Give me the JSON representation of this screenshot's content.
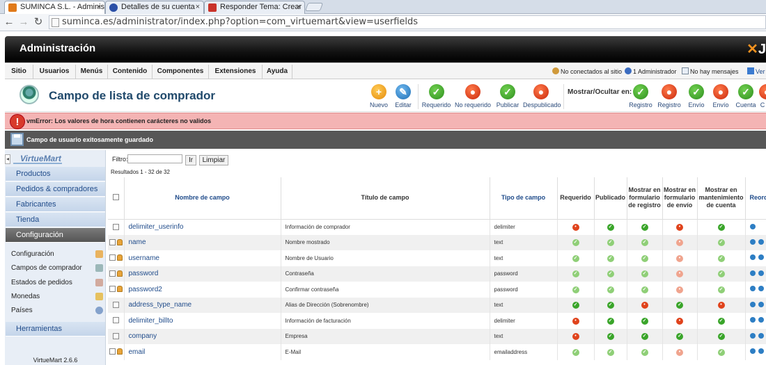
{
  "browser": {
    "tabs": [
      {
        "label": "SUMINCA S.L. - Administ",
        "color": "#e07a1a",
        "active": true
      },
      {
        "label": "Detalles de su cuenta",
        "color": "#2b4fa6",
        "active": false
      },
      {
        "label": "Responder Tema: Crear u",
        "color": "#c9332a",
        "active": false
      }
    ],
    "close_glyph": "×",
    "url": "suminca.es/administrator/index.php?option=com_virtuemart&view=userfields"
  },
  "header": {
    "title": "Administración",
    "logo_letter": "J"
  },
  "menu": [
    "Sitio",
    "Usuarios",
    "Menús",
    "Contenido",
    "Componentes",
    "Extensiones",
    "Ayuda"
  ],
  "status": {
    "visitors": "No conectados al sitio",
    "admins": "1 Administrador",
    "messages": "No hay mensajes",
    "view_site": "Ver si"
  },
  "toolbar": {
    "title": "Campo de lista de comprador",
    "buttons": [
      {
        "label": "Nuevo",
        "color": "o",
        "glyph": "+"
      },
      {
        "label": "Editar",
        "color": "b",
        "glyph": "✎"
      },
      {
        "label": "Requerido",
        "color": "g",
        "glyph": "✓"
      },
      {
        "label": "No requerido",
        "color": "r",
        "glyph": "●"
      },
      {
        "label": "Publicar",
        "color": "g",
        "glyph": "✓"
      },
      {
        "label": "Despublicado",
        "color": "r",
        "glyph": "●"
      }
    ],
    "show_hide": "Mostrar/Ocultar en:",
    "show_buttons": [
      {
        "label": "Registro",
        "color": "g",
        "glyph": "✓"
      },
      {
        "label": "Registro",
        "color": "r",
        "glyph": "●"
      },
      {
        "label": "Envío",
        "color": "g",
        "glyph": "✓"
      },
      {
        "label": "Envío",
        "color": "r",
        "glyph": "●"
      },
      {
        "label": "Cuenta",
        "color": "g",
        "glyph": "✓"
      },
      {
        "label": "C",
        "color": "r",
        "glyph": "●"
      }
    ]
  },
  "messages": {
    "error": "vmError: Los valores de hora contienen carácteres no validos",
    "success": "Campo de usuario exitosamente guardado"
  },
  "sidebar": {
    "logo": "VirtueMart",
    "items": [
      "Productos",
      "Pedidos & compradores",
      "Fabricantes",
      "Tienda",
      "Configuración"
    ],
    "sub_items": [
      "Configuración",
      "Campos de comprador",
      "Estados de pedidos",
      "Monedas",
      "Países"
    ],
    "tools": "Herramientas",
    "version": "VirtueMart 2.6.6"
  },
  "filter": {
    "label": "Filtro:",
    "value": "",
    "go": "Ir",
    "clear": "Limpiar"
  },
  "results": "Resultados 1 - 32 de 32",
  "columns": [
    "Nombre de campo",
    "Título de campo",
    "Tipo de campo",
    "Requerido",
    "Publicado",
    "Mostrar en formulario de registro",
    "Mostrar en formulario de envío",
    "Mostrar en mantenimiento de cuenta",
    "Reord"
  ],
  "rows": [
    {
      "name": "delimiter_userinfo",
      "title": "Información de comprador",
      "type": "delimiter",
      "locked": false,
      "flags": [
        "no",
        "ok",
        "ok",
        "no",
        "ok"
      ]
    },
    {
      "name": "name",
      "title": "Nombre mostrado",
      "type": "text",
      "locked": true,
      "flags": [
        "okl",
        "okl",
        "okl",
        "nol",
        "okl"
      ]
    },
    {
      "name": "username",
      "title": "Nombre de Usuario",
      "type": "text",
      "locked": true,
      "flags": [
        "okl",
        "okl",
        "okl",
        "nol",
        "okl"
      ]
    },
    {
      "name": "password",
      "title": "Contraseña",
      "type": "password",
      "locked": true,
      "flags": [
        "okl",
        "okl",
        "okl",
        "nol",
        "okl"
      ]
    },
    {
      "name": "password2",
      "title": "Confirmar contraseña",
      "type": "password",
      "locked": true,
      "flags": [
        "okl",
        "okl",
        "okl",
        "nol",
        "okl"
      ]
    },
    {
      "name": "address_type_name",
      "title": "Alias de Dirección (Sobrenombre)",
      "type": "text",
      "locked": false,
      "flags": [
        "ok",
        "ok",
        "no",
        "ok",
        "no"
      ]
    },
    {
      "name": "delimiter_billto",
      "title": "Información de facturación",
      "type": "delimiter",
      "locked": false,
      "flags": [
        "no",
        "ok",
        "ok",
        "no",
        "ok"
      ]
    },
    {
      "name": "company",
      "title": "Empresa",
      "type": "text",
      "locked": false,
      "flags": [
        "no",
        "ok",
        "ok",
        "ok",
        "ok"
      ]
    },
    {
      "name": "email",
      "title": "E-Mail",
      "type": "emailaddress",
      "locked": true,
      "flags": [
        "okl",
        "okl",
        "okl",
        "nol",
        "okl"
      ]
    }
  ]
}
